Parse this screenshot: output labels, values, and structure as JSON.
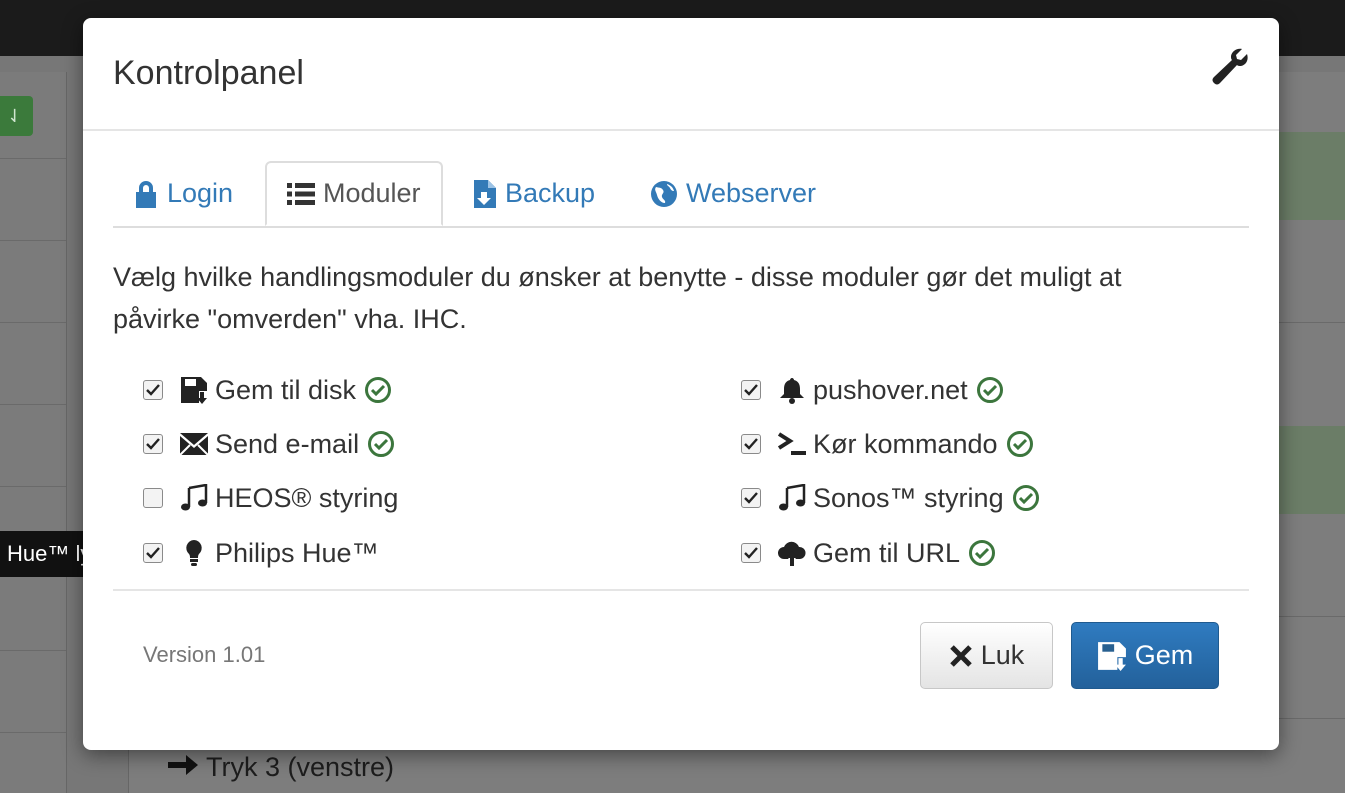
{
  "background": {
    "row_text": "Tryk 3 (venstre)"
  },
  "tooltip": {
    "text": "Hue™ lys"
  },
  "modal": {
    "title": "Kontrolpanel",
    "tabs": [
      {
        "label": "Login",
        "icon": "lock-icon",
        "active": false
      },
      {
        "label": "Moduler",
        "icon": "list-icon",
        "active": true
      },
      {
        "label": "Backup",
        "icon": "file-download-icon",
        "active": false
      },
      {
        "label": "Webserver",
        "icon": "globe-icon",
        "active": false
      }
    ],
    "description": "Vælg hvilke handlingsmoduler du ønsker at benytte - disse moduler gør det muligt at påvirke \"omverden\" vha. IHC.",
    "modules": [
      {
        "label": "Gem til disk",
        "icon": "floppy-save-icon",
        "checked": true,
        "ok": true
      },
      {
        "label": "pushover.net",
        "icon": "bell-icon",
        "checked": true,
        "ok": true
      },
      {
        "label": "Send e-mail",
        "icon": "envelope-icon",
        "checked": true,
        "ok": true
      },
      {
        "label": "Kør kommando",
        "icon": "terminal-icon",
        "checked": true,
        "ok": true
      },
      {
        "label": "HEOS® styring",
        "icon": "music-icon",
        "checked": false,
        "ok": false
      },
      {
        "label": "Sonos™ styring",
        "icon": "music-icon",
        "checked": true,
        "ok": true
      },
      {
        "label": "Philips Hue™",
        "icon": "lightbulb-icon",
        "checked": true,
        "ok": false
      },
      {
        "label": "Gem til URL",
        "icon": "cloud-upload-icon",
        "checked": true,
        "ok": true
      }
    ],
    "version": "Version 1.01",
    "buttons": {
      "close": "Luk",
      "save": "Gem"
    }
  },
  "colors": {
    "link": "#337ab7",
    "ok_green": "#3c763d",
    "primary": "#286090"
  }
}
